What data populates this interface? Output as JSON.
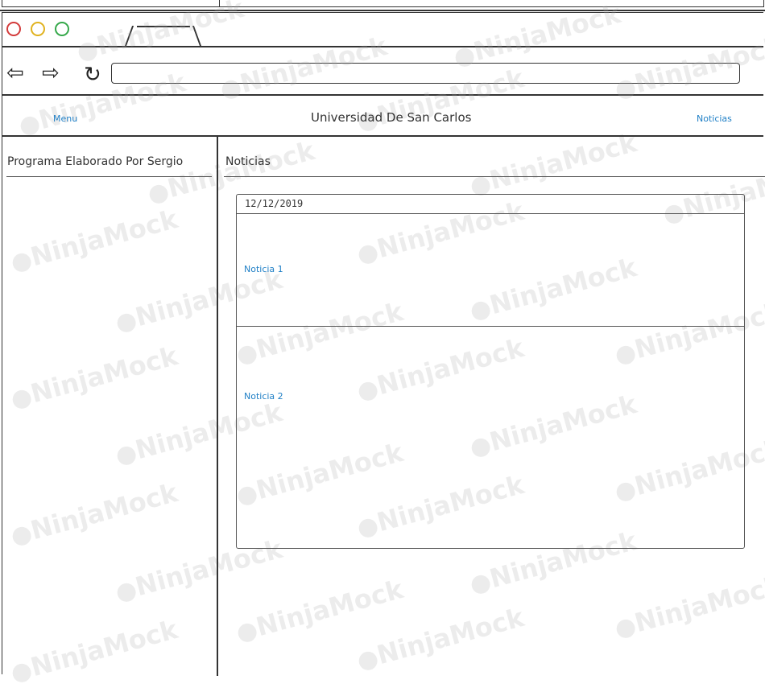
{
  "browser": {
    "url": "",
    "icons": {
      "back": "back-arrow-icon",
      "forward": "forward-arrow-icon",
      "reload": "reload-icon"
    },
    "traffic_light_colors": [
      "#d33b3b",
      "#e0b21f",
      "#35a84a"
    ]
  },
  "app": {
    "title": "Universidad De San Carlos",
    "nav_left": "Menu",
    "nav_right": "Noticias",
    "link_color": "#1f7fc6"
  },
  "sidebar": {
    "title": "Programa Elaborado Por Sergio"
  },
  "main": {
    "title": "Noticias",
    "card": {
      "date": "12/12/2019",
      "items": [
        {
          "label": "Noticia 1"
        },
        {
          "label": "Noticia 2"
        }
      ]
    }
  },
  "watermark": {
    "text": "NinjaMock"
  }
}
